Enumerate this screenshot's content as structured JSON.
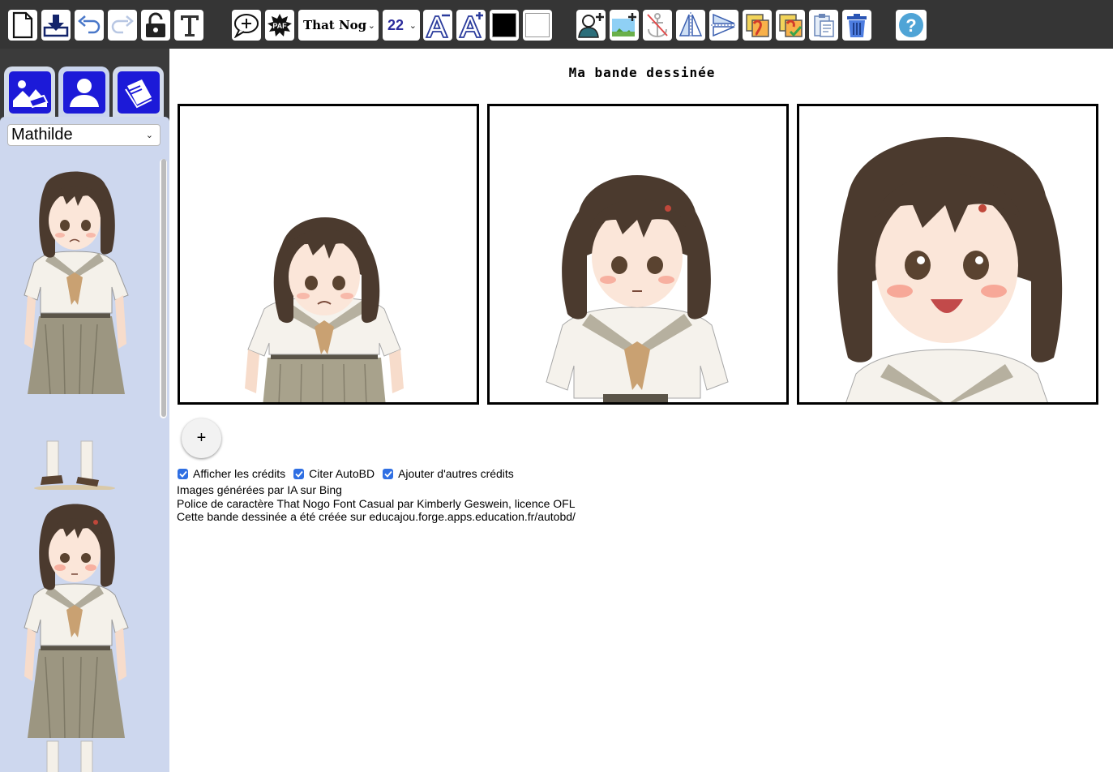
{
  "toolbar": {
    "font_name": "That Nogo",
    "font_size": "22",
    "text_color": "#000000",
    "bg_color": "#ffffff",
    "icons": [
      "new-page-icon",
      "download-icon",
      "undo-icon",
      "redo-icon",
      "lock-icon",
      "text-icon",
      "add-bubble-icon",
      "onomatopoeia-icon",
      "font-decrease-icon",
      "font-increase-icon",
      "add-character-icon",
      "add-background-icon",
      "anchor-icon",
      "flip-horizontal-icon",
      "flip-vertical-icon",
      "copy-style-icon",
      "paste-style-icon",
      "clipboard-icon",
      "trash-icon",
      "help-icon"
    ],
    "onomatopoeia_label": "PAF"
  },
  "sidebar": {
    "tabs": [
      {
        "name": "backgrounds",
        "icon": "scenery-icon"
      },
      {
        "name": "characters",
        "icon": "person-icon",
        "active": true
      },
      {
        "name": "book",
        "icon": "book-icon"
      }
    ],
    "character_select": "Mathilde",
    "characters": [
      {
        "name": "Mathilde",
        "pose": "full-body-sad"
      },
      {
        "name": "Mathilde",
        "pose": "full-body-pout"
      }
    ]
  },
  "main": {
    "title": "Ma bande dessinée",
    "panels": [
      {
        "id": 1,
        "shot": "full body, sad"
      },
      {
        "id": 2,
        "shot": "medium, pout"
      },
      {
        "id": 3,
        "shot": "close-up, laughing"
      }
    ],
    "add_panel_label": "+",
    "credit_options": [
      {
        "label": "Afficher les crédits",
        "checked": true
      },
      {
        "label": "Citer AutoBD",
        "checked": true
      },
      {
        "label": "Ajouter d'autres crédits",
        "checked": true
      }
    ],
    "credits": [
      "Images générées par IA sur Bing",
      "Police de caractère That Nogo Font Casual par Kimberly Geswein, licence OFL",
      "Cette bande dessinée a été créée sur educajou.forge.apps.education.fr/autobd/"
    ]
  }
}
